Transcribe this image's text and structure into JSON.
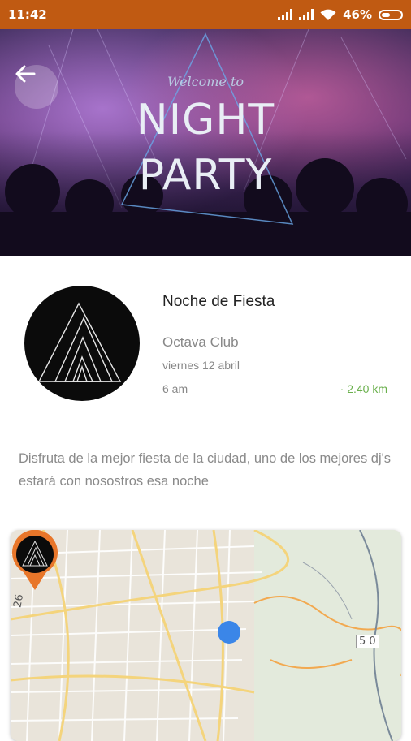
{
  "status_bar": {
    "time": "11:42",
    "battery_percent": "46%",
    "battery_level": 0.46
  },
  "banner": {
    "welcome_text": "Welcome to",
    "line1": "NIGHT",
    "line2": "PARTY"
  },
  "event": {
    "title": "Noche de Fiesta",
    "venue": "Octava Club",
    "date": "viernes 12 abril",
    "time": "6 am",
    "distance": "· 2.40 km",
    "description": "Disfruta de la mejor fiesta de la ciudad, uno de los mejores dj's estará con nosostros esa noche"
  },
  "map": {
    "road_label_left": "26",
    "road_label_right": "5 0"
  },
  "colors": {
    "status_bar": "#c05a12",
    "accent_orange": "#e8762a",
    "distance_green": "#6ab04c",
    "location_blue": "#3b86e8"
  },
  "icons": {
    "back": "arrow-left-icon",
    "wifi": "wifi-icon",
    "signal": "signal-icon",
    "battery": "battery-icon",
    "pin": "map-pin-icon",
    "location": "current-location-icon"
  }
}
